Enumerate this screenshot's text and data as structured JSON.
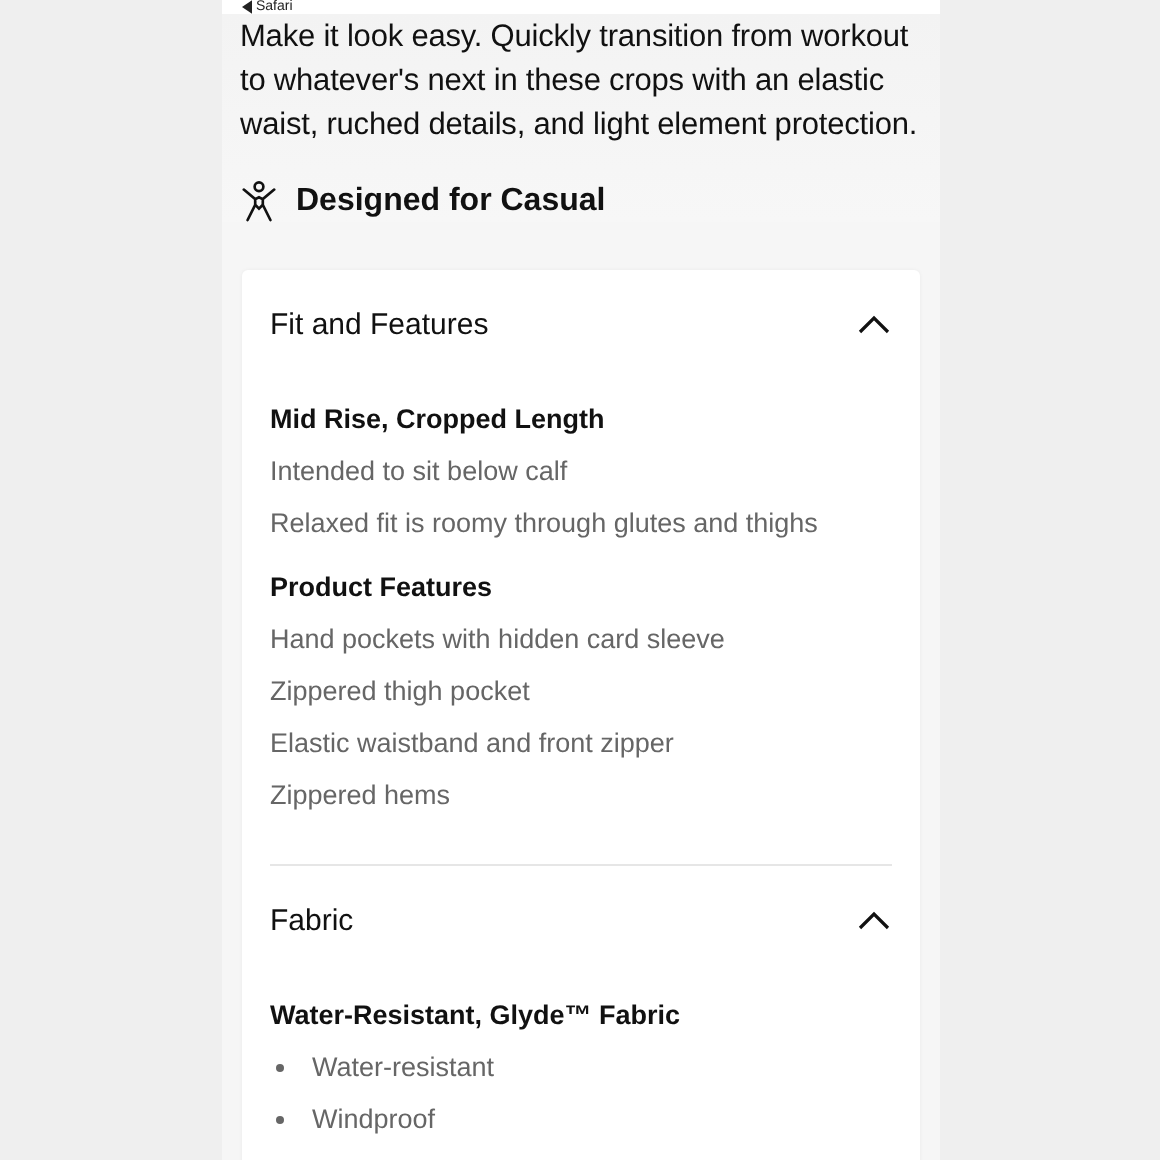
{
  "status_bar": {
    "back_label": "Safari"
  },
  "description": "Make it look easy. Quickly transition from workout to whatever's next in these crops with an elastic waist, ruched details, and light element protection.",
  "activity": {
    "label": "Designed for Casual"
  },
  "sections": [
    {
      "title": "Fit and Features",
      "expanded": true,
      "groups": [
        {
          "heading": "Mid Rise, Cropped Length",
          "kind": "plain",
          "items": [
            "Intended to sit below calf",
            "Relaxed fit is roomy through glutes and thighs"
          ]
        },
        {
          "heading": "Product Features",
          "kind": "plain",
          "items": [
            "Hand pockets with hidden card sleeve",
            "Zippered thigh pocket",
            "Elastic waistband and front zipper",
            "Zippered hems"
          ]
        }
      ]
    },
    {
      "title": "Fabric",
      "expanded": true,
      "groups": [
        {
          "heading": "Water-Resistant, Glyde™ Fabric",
          "kind": "bullets",
          "items": [
            "Water-resistant",
            "Windproof"
          ]
        }
      ]
    }
  ]
}
